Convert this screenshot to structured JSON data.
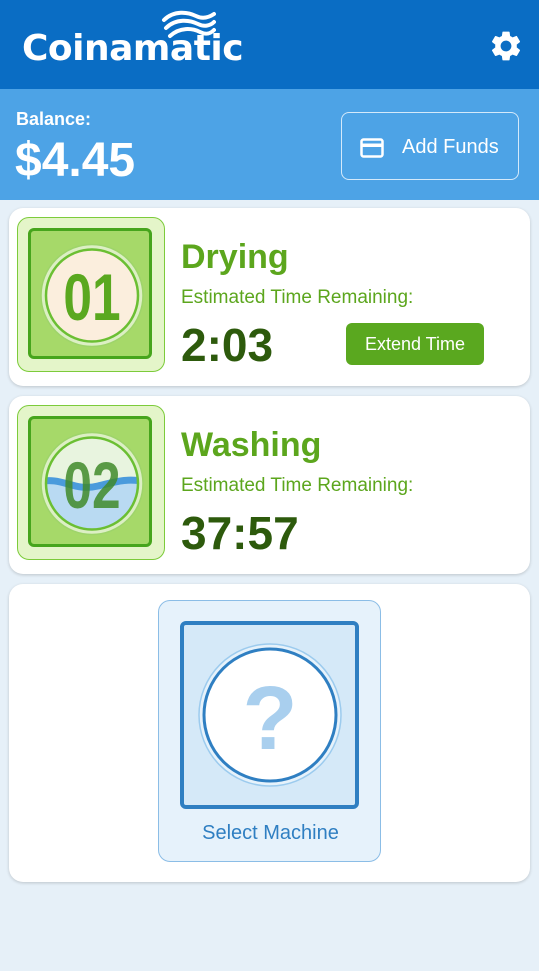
{
  "app": {
    "title": "Coinamatic",
    "settings_icon": "gear-icon",
    "brand_color": "#0a6dc4"
  },
  "balance": {
    "label": "Balance:",
    "amount": "$4.45"
  },
  "add_funds": {
    "label": "Add Funds",
    "icon": "credit-card-icon"
  },
  "machines": [
    {
      "number": "01",
      "status": "Drying",
      "time_label": "Estimated Time Remaining:",
      "time": "2:03",
      "action": "Extend Time"
    },
    {
      "number": "02",
      "status": "Washing",
      "time_label": "Estimated Time Remaining:",
      "time": "37:57"
    }
  ],
  "select_machine": {
    "symbol": "?",
    "label": "Select Machine"
  },
  "colors": {
    "active_green": "#5ca61d",
    "dark_green": "#2d5a0c",
    "select_blue": "#2f7fc2"
  }
}
